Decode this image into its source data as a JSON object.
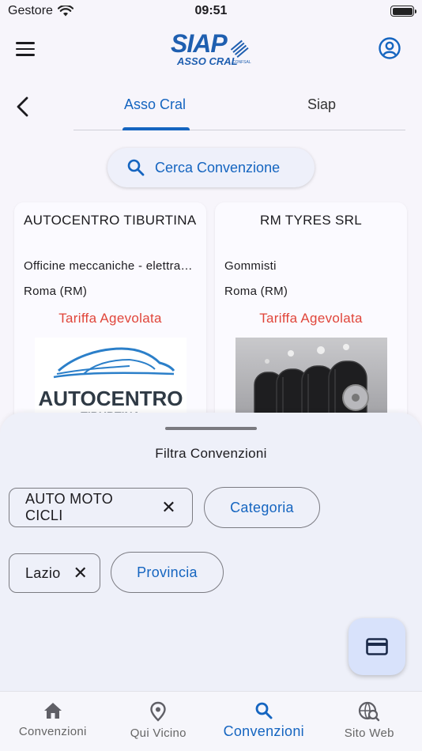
{
  "status_bar": {
    "carrier": "Gestore",
    "time": "09:51"
  },
  "app_bar": {
    "logo_text": "SIAP",
    "logo_subtext": "ASSO CRAL",
    "logo_brand": "CONFSAL",
    "menu_icon": "hamburger-menu-icon",
    "account_icon": "account-circle-icon"
  },
  "tabs": [
    {
      "label": "Asso Cral",
      "active": true
    },
    {
      "label": "Siap",
      "active": false
    }
  ],
  "search_button": {
    "label": "Cerca Convenzione",
    "icon": "search-icon"
  },
  "cards": [
    {
      "title": "AUTOCENTRO TIBURTINA",
      "category": "Officine meccaniche - elettrauto - carrozzerie",
      "location": "Roma (RM)",
      "tariff": "Tariffa Agevolata",
      "logo_text": "AUTOCENTRO",
      "logo_subtext": "TIBURTINA"
    },
    {
      "title": "RM TYRES SRL",
      "category": "Gommisti",
      "location": "Roma (RM)",
      "tariff": "Tariffa Agevolata"
    }
  ],
  "filter_sheet": {
    "title": "Filtra Convenzioni",
    "selected_category": "AUTO MOTO CICLI",
    "category_button": "Categoria",
    "selected_region": "Lazio",
    "province_button": "Provincia",
    "close_glyph": "✕"
  },
  "fab": {
    "icon": "credit-card-icon"
  },
  "bottom_nav": [
    {
      "label": "Convenzioni",
      "icon": "home-icon",
      "active": false
    },
    {
      "label": "Qui Vicino",
      "icon": "location-pin-icon",
      "active": false
    },
    {
      "label": "Convenzioni",
      "icon": "search-icon",
      "active": true
    },
    {
      "label": "Sito Web",
      "icon": "globe-search-icon",
      "active": false
    }
  ],
  "colors": {
    "accent": "#1565c0",
    "tariff": "#e0453a",
    "sheet": "#eef0f9",
    "fab": "#d8e2fb"
  }
}
